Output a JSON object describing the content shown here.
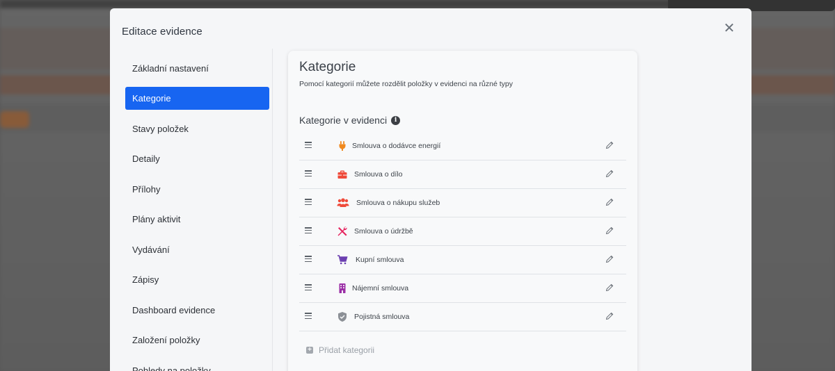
{
  "modal": {
    "title": "Editace evidence",
    "close_icon": "close-icon"
  },
  "sidebar": {
    "items": [
      {
        "label": "Základní nastavení",
        "active": false
      },
      {
        "label": "Kategorie",
        "active": true
      },
      {
        "label": "Stavy položek",
        "active": false
      },
      {
        "label": "Detaily",
        "active": false
      },
      {
        "label": "Přílohy",
        "active": false
      },
      {
        "label": "Plány aktivit",
        "active": false
      },
      {
        "label": "Vydávání",
        "active": false
      },
      {
        "label": "Zápisy",
        "active": false
      },
      {
        "label": "Dashboard evidence",
        "active": false
      },
      {
        "label": "Založení položky",
        "active": false
      },
      {
        "label": "Pohledy na položky",
        "active": false
      }
    ]
  },
  "content": {
    "title": "Kategorie",
    "subtitle": "Pomocí kategorií můžete rozdělit položky v evidenci na různé typy",
    "section_title": "Kategorie v evidenci",
    "categories": [
      {
        "label": "Smlouva o dodávce energií",
        "icon": "plug-icon",
        "color": "#f0891e"
      },
      {
        "label": "Smlouva o dílo",
        "icon": "briefcase-icon",
        "color": "#ef4a3a"
      },
      {
        "label": "Smlouva o nákupu služeb",
        "icon": "users-icon",
        "color": "#ef4a3a"
      },
      {
        "label": "Smlouva o údržbě",
        "icon": "tools-icon",
        "color": "#e5255f"
      },
      {
        "label": "Kupní smlouva",
        "icon": "cart-icon",
        "color": "#6b3fb0"
      },
      {
        "label": "Nájemní smlouva",
        "icon": "building-icon",
        "color": "#9b2fa6"
      },
      {
        "label": "Pojistná smlouva",
        "icon": "shield-icon",
        "color": "#8c9096"
      }
    ],
    "add_label": "Přidat kategorii"
  },
  "colors": {
    "accent": "#1765f1",
    "background": "#f5f6f8"
  }
}
